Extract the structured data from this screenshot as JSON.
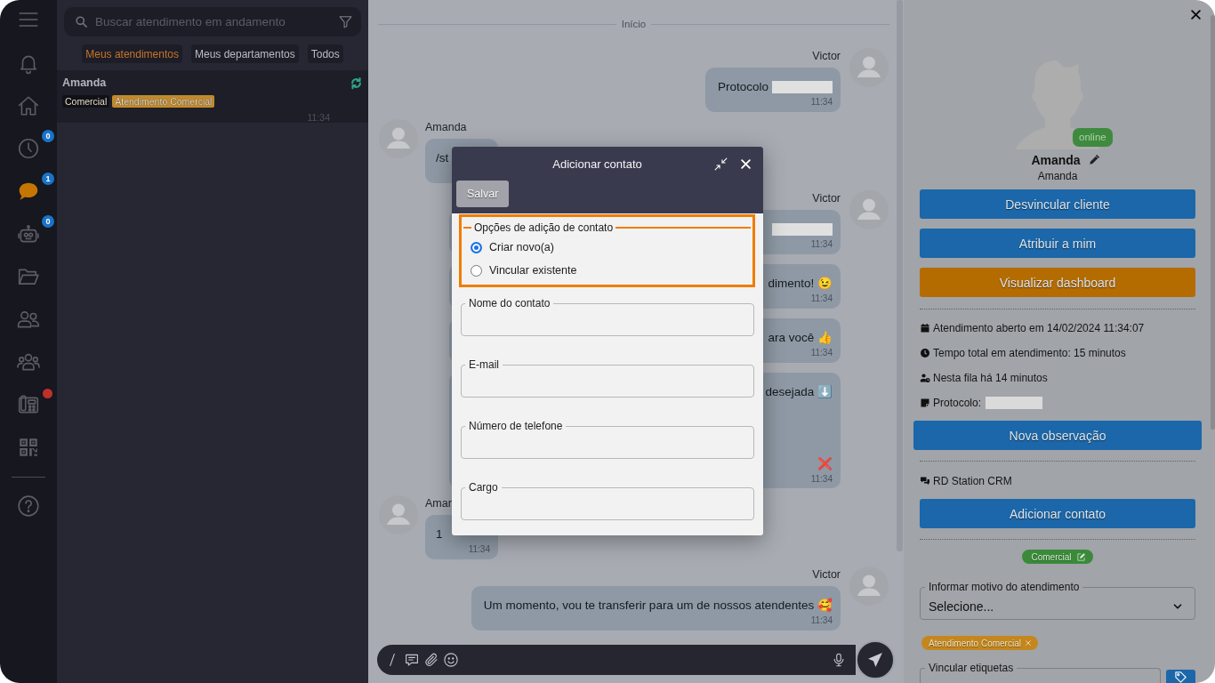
{
  "sidebar": {
    "items": [
      {
        "selected": false,
        "alert": false
      },
      {
        "selected": false,
        "alert": false
      },
      {
        "selected": false,
        "badge": "0",
        "alert": false
      },
      {
        "selected": true,
        "badge": "1",
        "alert": false
      },
      {
        "selected": false,
        "badge": "0",
        "alert": false
      },
      {
        "selected": false,
        "alert": false
      },
      {
        "selected": false,
        "alert": false
      },
      {
        "selected": false,
        "alert": false
      },
      {
        "selected": false,
        "alert": true
      },
      {
        "selected": false,
        "alert": false
      }
    ]
  },
  "conversations": {
    "search": {
      "placeholder": "Buscar atendimento em andamento"
    },
    "filters": [
      {
        "label": "Meus atendimentos",
        "selected": true
      },
      {
        "label": "Meus departamentos",
        "selected": false
      },
      {
        "label": "Todos",
        "selected": false
      }
    ],
    "items": [
      {
        "name": "Amanda",
        "selected": true,
        "tags": [
          {
            "label": "Comercial",
            "color": "#111217"
          },
          {
            "label": "Atendimento Comercial",
            "color": "#c28a2c"
          }
        ],
        "time": "11:34"
      }
    ]
  },
  "chat": {
    "divider": "Início",
    "groups": [
      {
        "kind": "outgoing",
        "sender": "Victor",
        "bubbles": [
          {
            "text": "Protocolo",
            "redacted": true,
            "obscured": false,
            "time": "11:34"
          }
        ]
      },
      {
        "kind": "incoming",
        "sender": "Amanda",
        "bubbles": [
          {
            "text": "/st"
          }
        ]
      },
      {
        "kind": "outgoing",
        "sender": "Victor",
        "bubbles": [
          {
            "redacted": true,
            "obscured": true,
            "time": "11:34"
          },
          {
            "text": "dimento! 😉",
            "redacted": false,
            "obscured": true,
            "time": "11:34"
          },
          {
            "text": "ara você 👍",
            "redacted": false,
            "obscured": true,
            "time": "11:34"
          },
          {
            "lines": [
              "desejada ⬇️",
              "❌"
            ],
            "redacted": false,
            "obscured": true,
            "time": "11:34"
          }
        ]
      },
      {
        "kind": "incoming",
        "sender": "Amar",
        "bubbles": [
          {
            "text": "1",
            "time": "11:34"
          }
        ]
      },
      {
        "kind": "outgoing",
        "sender": "Victor",
        "bubbles": [
          {
            "text": "Um momento, vou te transferir para um de nossos atendentes 🥰",
            "redacted": false,
            "obscured": false,
            "time": "11:34"
          }
        ]
      }
    ]
  },
  "dialog": {
    "title": "Adicionar contato",
    "save_button": "Salvar",
    "options": {
      "legend": "Opções de adição de contato",
      "items": [
        {
          "label": "Criar novo(a)",
          "selected": true
        },
        {
          "label": "Vincular existente",
          "selected": false
        }
      ]
    },
    "fields": [
      {
        "label": "Nome do contato"
      },
      {
        "label": "E-mail"
      },
      {
        "label": "Número de telefone"
      },
      {
        "label": "Cargo"
      }
    ]
  },
  "contact_panel": {
    "status": "online",
    "name": "Amanda",
    "subtitle": "Amanda",
    "actions": [
      {
        "label": "Desvincular cliente",
        "kind": "primary"
      },
      {
        "label": "Atribuir a mim",
        "kind": "primary"
      },
      {
        "label": "Visualizar dashboard",
        "kind": "warning"
      }
    ],
    "details": [
      {
        "text": "Atendimento aberto em 14/02/2024 11:34:07",
        "redacted": false
      },
      {
        "text": "Tempo total em atendimento: 15 minutos",
        "redacted": false
      },
      {
        "text": "Nesta fila há 14 minutos",
        "redacted": false
      },
      {
        "text": "Protocolo:",
        "redacted": true
      }
    ],
    "note_button": "Nova observação",
    "integration": {
      "title": "RD Station CRM",
      "button": "Adicionar contato"
    },
    "department_tag": "Comercial",
    "reason_select": {
      "label": "Informar motivo do atendimento",
      "value": "Selecione..."
    },
    "tags": [
      {
        "label": "Atendimento Comercial"
      }
    ],
    "tag_select": {
      "label": "Vincular etiquetas"
    }
  }
}
